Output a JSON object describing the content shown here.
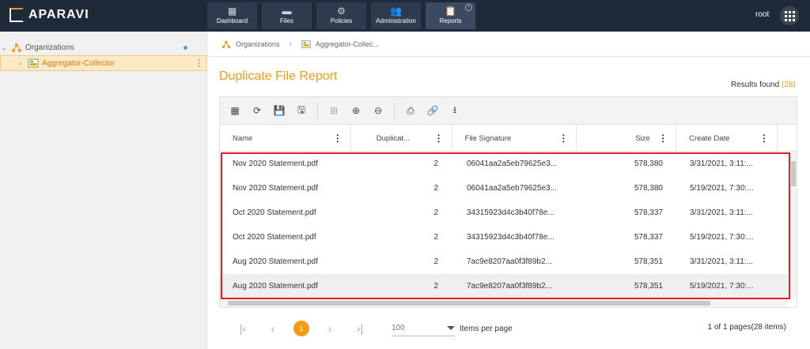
{
  "app": {
    "logo_text": "APARAVI",
    "user": "root"
  },
  "nav": {
    "tabs": [
      {
        "label": "Dashboard",
        "icon": "dashboard-icon"
      },
      {
        "label": "Files",
        "icon": "folder-icon"
      },
      {
        "label": "Policies",
        "icon": "gear-icon"
      },
      {
        "label": "Administration",
        "icon": "users-icon"
      },
      {
        "label": "Reports",
        "icon": "clipboard-icon",
        "active": true
      }
    ]
  },
  "sidebar": {
    "items": [
      {
        "label": "Organizations",
        "icon": "organization-icon"
      },
      {
        "label": "Aggregator-Collector",
        "icon": "aggregator-icon",
        "selected": true
      }
    ]
  },
  "breadcrumb": {
    "items": [
      "Organizations",
      "Aggregator-Collec..."
    ]
  },
  "report": {
    "title": "Duplicate File Report",
    "results_label": "Results found",
    "results_count": "(28)"
  },
  "toolbar": {
    "icons": [
      "table-icon",
      "refresh-icon",
      "save-icon",
      "save-as-icon",
      "group-icon",
      "expand-icon",
      "collapse-icon",
      "print-icon",
      "link-icon",
      "download-icon"
    ]
  },
  "table": {
    "columns": [
      "Name",
      "Duplicat...",
      "File Signature",
      "Size",
      "Create Date"
    ],
    "rows": [
      [
        "Nov 2020 Statement.pdf",
        "2",
        "06041aa2a5eb79625e3...",
        "578,380",
        "3/31/2021, 3:11:..."
      ],
      [
        "Nov 2020 Statement.pdf",
        "2",
        "06041aa2a5eb79625e3...",
        "578,380",
        "5/19/2021, 7:30:..."
      ],
      [
        "Oct 2020 Statement.pdf",
        "2",
        "34315923d4c3b40f78e...",
        "578,337",
        "3/31/2021, 3:11:..."
      ],
      [
        "Oct 2020 Statement.pdf",
        "2",
        "34315923d4c3b40f78e...",
        "578,337",
        "5/19/2021, 7:30:..."
      ],
      [
        "Aug 2020 Statement.pdf",
        "2",
        "7ac9e8207aa0f3f89b2...",
        "578,351",
        "3/31/2021, 3:11:..."
      ],
      [
        "Aug 2020 Statement.pdf",
        "2",
        "7ac9e8207aa0f3f89b2...",
        "578,351",
        "5/19/2021, 7:30:..."
      ]
    ]
  },
  "pager": {
    "current_page": "1",
    "per_page": "100",
    "per_page_label": "Items per page",
    "info": "1 of 1 pages(28 items)"
  },
  "colors": {
    "accent": "#f39c12",
    "topbar": "#1e2a3a",
    "highlight": "#e0202a"
  }
}
